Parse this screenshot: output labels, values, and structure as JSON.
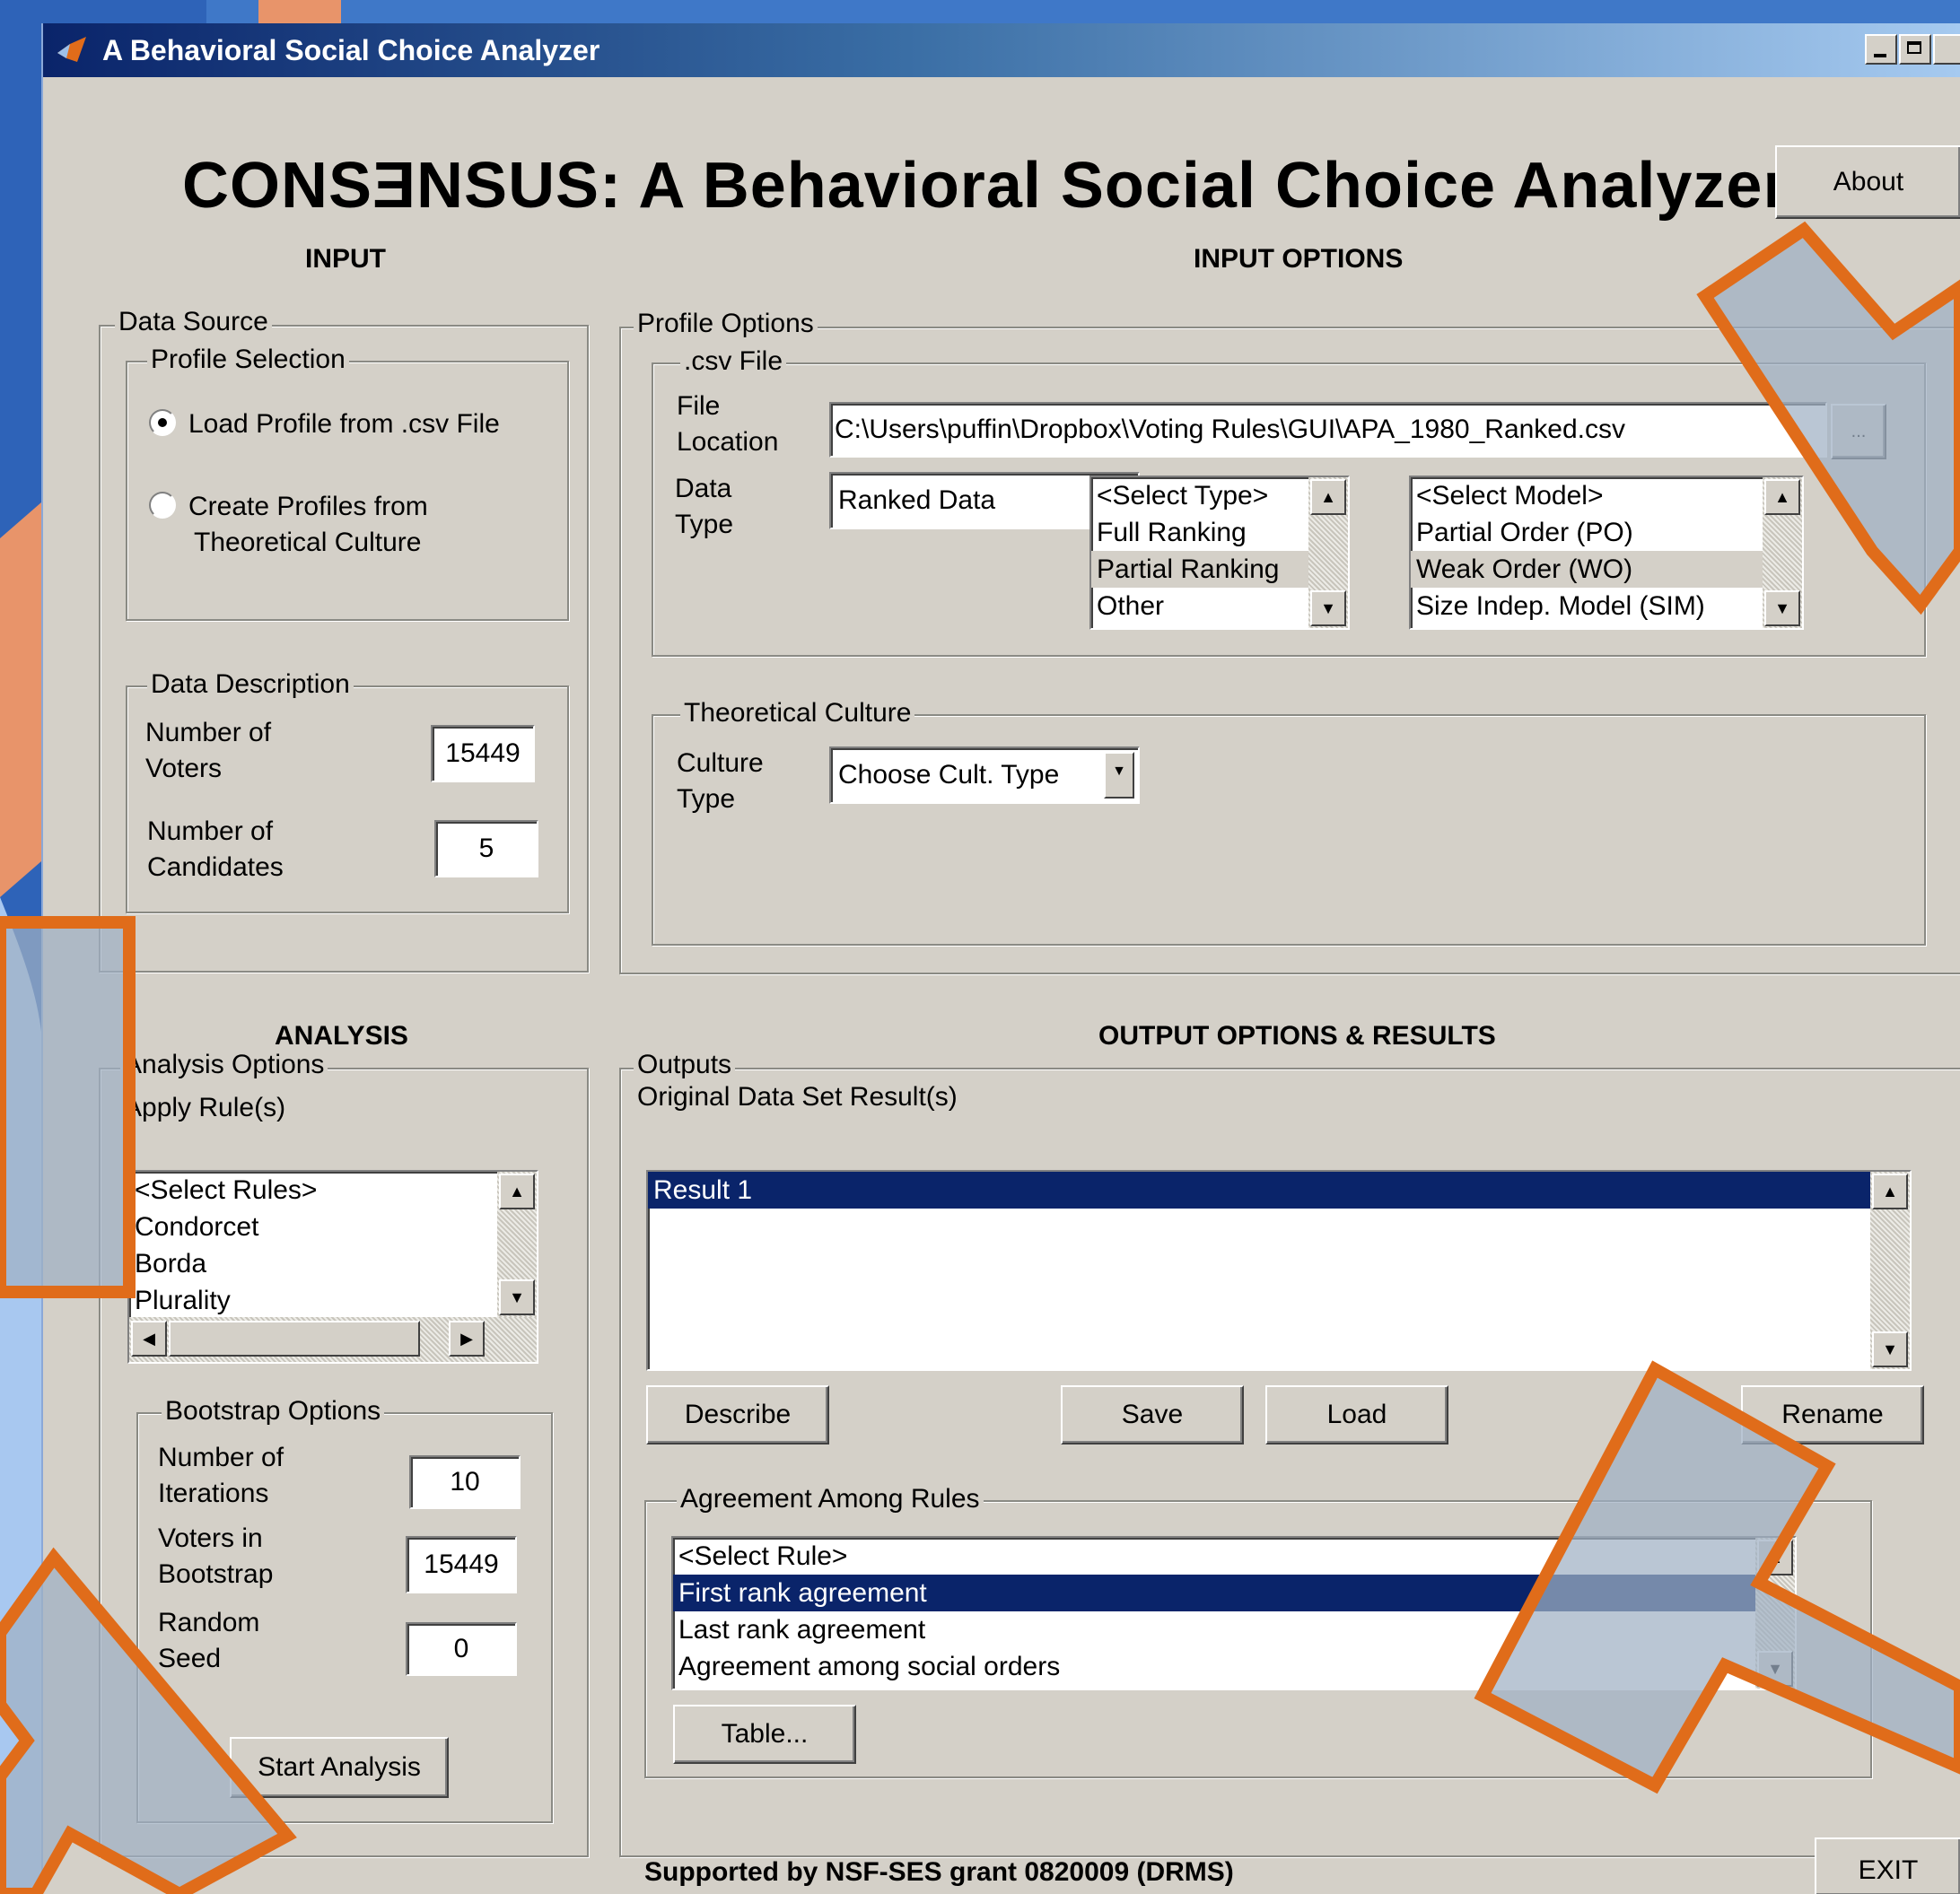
{
  "window": {
    "title": "A Behavioral Social Choice Analyzer"
  },
  "header": {
    "title": "CONSƎNSUS: A Behavioral Social Choice Analyzer",
    "about_label": "About"
  },
  "sections": {
    "input": "INPUT",
    "input_options": "INPUT OPTIONS",
    "analysis": "ANALYSIS",
    "output": "OUTPUT OPTIONS & RESULTS"
  },
  "data_source": {
    "label": "Data Source",
    "profile_selection": {
      "label": "Profile Selection",
      "options": [
        "Load Profile from .csv File",
        "Create Profiles from",
        "Theoretical Culture"
      ],
      "selected_index": 0
    },
    "description": {
      "label": "Data Description",
      "voters_label": [
        "Number of",
        "Voters"
      ],
      "voters_value": "15449",
      "candidates_label": [
        "Number of",
        "Candidates"
      ],
      "candidates_value": "5"
    }
  },
  "profile_options": {
    "label": "Profile Options",
    "csv": {
      "label": ".csv File",
      "file_label": [
        "File",
        "Location"
      ],
      "file_value": "C:\\Users\\puffin\\Dropbox\\Voting Rules\\GUI\\APA_1980_Ranked.csv",
      "browse_label": "...",
      "data_type_label": [
        "Data",
        "Type"
      ],
      "data_type_value": "Ranked Data",
      "type_list": [
        "<Select Type>",
        "Full Ranking",
        "Partial Ranking",
        "Other"
      ],
      "model_list": [
        "<Select Model>",
        "Partial Order (PO)",
        "Weak Order (WO)",
        "Size Indep. Model (SIM)"
      ]
    },
    "culture": {
      "label": "Theoretical Culture",
      "type_label": [
        "Culture",
        "Type"
      ],
      "type_value": "Choose Cult. Type"
    }
  },
  "analysis": {
    "label": "Analysis Options",
    "apply_label": "Apply Rule(s)",
    "rules": [
      "<Select Rules>",
      "Condorcet",
      "Borda",
      "Plurality"
    ],
    "bootstrap": {
      "label": "Bootstrap Options",
      "iterations_label": [
        "Number of",
        "Iterations"
      ],
      "iterations_value": "10",
      "voters_label": [
        "Voters in",
        "Bootstrap"
      ],
      "voters_value": "15449",
      "seed_label": [
        "Random",
        "Seed"
      ],
      "seed_value": "0"
    },
    "start_label": "Start Analysis"
  },
  "outputs": {
    "label": "Outputs",
    "original_label": "Original Data Set Result(s)",
    "results": [
      "Result 1"
    ],
    "describe_label": "Describe",
    "save_label": "Save",
    "load_label": "Load",
    "rename_label": "Rename",
    "agreement": {
      "label": "Agreement Among Rules",
      "items": [
        "<Select Rule>",
        "First rank agreement",
        "Last rank  agreement",
        "Agreement among social orders"
      ],
      "selected_index": 1,
      "table_label": "Table..."
    }
  },
  "footer": {
    "support_text": "Supported by NSF-SES grant 0820009 (DRMS)",
    "exit_label": "EXIT"
  },
  "colors": {
    "accent_orange": "#e06c1a",
    "selection_blue": "#0a246a",
    "panel_gray": "#d4d0c8"
  }
}
